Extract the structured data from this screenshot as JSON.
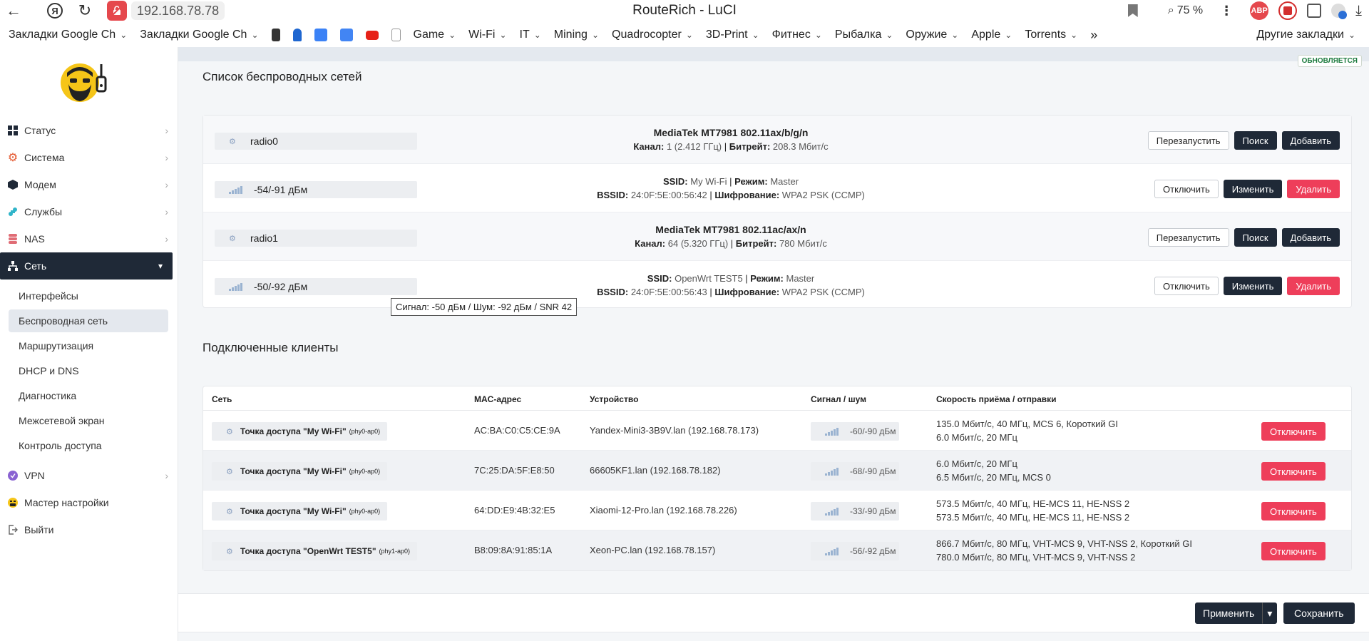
{
  "browser": {
    "url": "192.168.78.78",
    "title": "RouteRich - LuCI",
    "zoom": "75 %",
    "extensions": [
      {
        "name": "abp-icon",
        "label": "ABP",
        "color": "#e5484d"
      },
      {
        "name": "shield-icon",
        "label": "",
        "color": "#d32f2f"
      }
    ],
    "bookmarks": [
      {
        "label": "Закладки Google Ch",
        "folder": true
      },
      {
        "label": "Закладки Google Ch",
        "folder": true
      },
      {
        "label": "Game",
        "folder": true
      },
      {
        "label": "Wi-Fi",
        "folder": true
      },
      {
        "label": "IT",
        "folder": true
      },
      {
        "label": "Mining",
        "folder": true
      },
      {
        "label": "Quadrocopter",
        "folder": true
      },
      {
        "label": "3D-Print",
        "folder": true
      },
      {
        "label": "Фитнес",
        "folder": true
      },
      {
        "label": "Рыбалка",
        "folder": true
      },
      {
        "label": "Оружие",
        "folder": true
      },
      {
        "label": "Apple",
        "folder": true
      },
      {
        "label": "Torrents",
        "folder": true
      }
    ],
    "bookmarks_more": "»",
    "bookmarks_other": "Другие закладки"
  },
  "sidebar": {
    "items": [
      {
        "label": "Статус",
        "icon": "grid-icon",
        "color": "#1f2937"
      },
      {
        "label": "Система",
        "icon": "gear-icon",
        "color": "#e4572e"
      },
      {
        "label": "Модем",
        "icon": "cube-icon",
        "color": "#1f2937"
      },
      {
        "label": "Службы",
        "icon": "puzzle-icon",
        "color": "#2fb4c9"
      },
      {
        "label": "NAS",
        "icon": "database-icon",
        "color": "#e06c75"
      },
      {
        "label": "Сеть",
        "icon": "network-icon",
        "color": "#ffffff",
        "active": true
      }
    ],
    "sub_items": [
      {
        "label": "Интерфейсы"
      },
      {
        "label": "Беспроводная сеть",
        "active": true
      },
      {
        "label": "Маршрутизация"
      },
      {
        "label": "DHCP и DNS"
      },
      {
        "label": "Диагностика"
      },
      {
        "label": "Межсетевой экран"
      },
      {
        "label": "Контроль доступа"
      }
    ],
    "items_after": [
      {
        "label": "VPN",
        "icon": "vpn-icon",
        "color": "#8a63d2",
        "arrow": true
      },
      {
        "label": "Мастер настройки",
        "icon": "wizard-icon",
        "color": "#f5c518",
        "arrow": false
      },
      {
        "label": "Выйти",
        "icon": "logout-icon",
        "color": "#666666",
        "arrow": false
      }
    ]
  },
  "main": {
    "refresh_badge": "ОБНОВЛЯЕТСЯ",
    "wireless_title": "Список беспроводных сетей",
    "labels": {
      "channel": "Канал:",
      "bitrate": "Битрейт:",
      "ssid": "SSID:",
      "mode": "Режим:",
      "bssid": "BSSID:",
      "encryption": "Шифрование:"
    },
    "radios": [
      {
        "name": "radio0",
        "device": "MediaTek MT7981 802.11ax/b/g/n",
        "channel": "1 (2.412 ГГц)",
        "bitrate": "208.3 Мбит/с",
        "buttons": [
          "Перезапустить",
          "Поиск",
          "Добавить"
        ],
        "network": {
          "signal": "-54/-91 дБм",
          "ssid": "My Wi-Fi",
          "mode": "Master",
          "bssid": "24:0F:5E:00:56:42",
          "encryption": "WPA2 PSK (CCMP)",
          "buttons": [
            "Отключить",
            "Изменить",
            "Удалить"
          ]
        }
      },
      {
        "name": "radio1",
        "device": "MediaTek MT7981 802.11ac/ax/n",
        "channel": "64 (5.320 ГГц)",
        "bitrate": "780 Мбит/с",
        "buttons": [
          "Перезапустить",
          "Поиск",
          "Добавить"
        ],
        "network": {
          "signal": "-50/-92 дБм",
          "ssid": "OpenWrt TEST5",
          "mode": "Master",
          "bssid": "24:0F:5E:00:56:43",
          "encryption": "WPA2 PSK (CCMP)",
          "buttons": [
            "Отключить",
            "Изменить",
            "Удалить"
          ]
        }
      }
    ],
    "tooltip": "Сигнал: -50 дБм / Шум: -92 дБм / SNR 42",
    "clients_title": "Подключенные клиенты",
    "clients_headers": [
      "Сеть",
      "MAC-адрес",
      "Устройство",
      "Сигнал / шум",
      "Скорость приёма / отправки"
    ],
    "clients": [
      {
        "network": "Точка доступа \"My Wi-Fi\"",
        "iface": "(phy0-ap0)",
        "mac": "AC:BA:C0:C5:CE:9A",
        "device": "Yandex-Mini3-3B9V.lan (192.168.78.173)",
        "signal": "-60/-90 дБм",
        "rx": "135.0 Мбит/с, 40 МГц, MCS 6, Короткий GI",
        "tx": "6.0 Мбит/с, 20 МГц",
        "button": "Отключить"
      },
      {
        "network": "Точка доступа \"My Wi-Fi\"",
        "iface": "(phy0-ap0)",
        "mac": "7C:25:DA:5F:E8:50",
        "device": "66605KF1.lan (192.168.78.182)",
        "signal": "-68/-90 дБм",
        "rx": "6.0 Мбит/с, 20 МГц",
        "tx": "6.5 Мбит/с, 20 МГц, MCS 0",
        "button": "Отключить"
      },
      {
        "network": "Точка доступа \"My Wi-Fi\"",
        "iface": "(phy0-ap0)",
        "mac": "64:DD:E9:4B:32:E5",
        "device": "Xiaomi-12-Pro.lan (192.168.78.226)",
        "signal": "-33/-90 дБм",
        "rx": "573.5 Мбит/с, 40 МГц, HE-MCS 11, HE-NSS 2",
        "tx": "573.5 Мбит/с, 40 МГц, HE-MCS 11, HE-NSS 2",
        "button": "Отключить"
      },
      {
        "network": "Точка доступа \"OpenWrt TEST5\"",
        "iface": "(phy1-ap0)",
        "mac": "B8:09:8A:91:85:1A",
        "device": "Xeon-PC.lan (192.168.78.157)",
        "signal": "-56/-92 дБм",
        "rx": "866.7 Мбит/с, 80 МГц, VHT-MCS 9, VHT-NSS 2, Короткий GI",
        "tx": "780.0 Мбит/с, 80 МГц, VHT-MCS 9, VHT-NSS 2",
        "button": "Отключить"
      }
    ],
    "apply_label": "Применить",
    "apply_dropdown": "▾",
    "save_label": "Сохранить"
  },
  "colors": {
    "dark": "#1f2937",
    "danger": "#ee3e5a",
    "accent": "#e5484d"
  }
}
